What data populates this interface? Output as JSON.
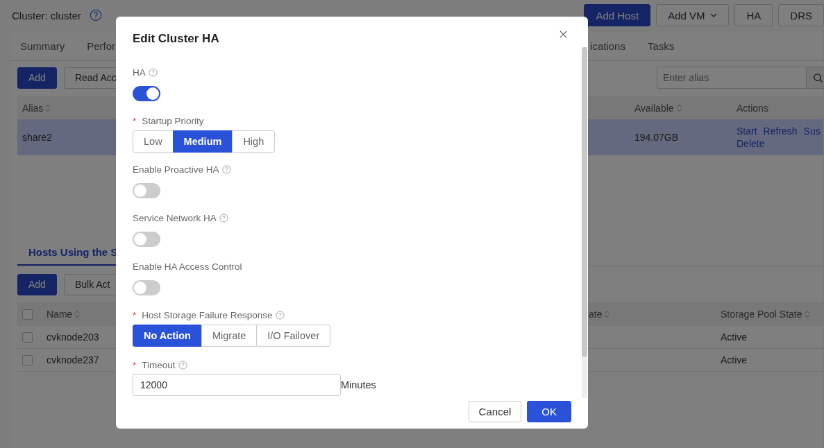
{
  "header": {
    "title": "Cluster: cluster",
    "buttons": [
      {
        "label": "Add Host",
        "kind": "primary"
      },
      {
        "label": "Add VM",
        "kind": "dropdown"
      },
      {
        "label": "HA",
        "kind": "plain"
      },
      {
        "label": "DRS",
        "kind": "plain"
      }
    ]
  },
  "tabs": [
    {
      "label": "Summary",
      "selected": false
    },
    {
      "label": "Perfor",
      "selected": false
    },
    {
      "label": "ications",
      "selected": false
    },
    {
      "label": "Tasks",
      "selected": false
    }
  ],
  "storage": {
    "buttons": [
      {
        "label": "Add",
        "kind": "primary"
      },
      {
        "label": "Read Acc",
        "kind": "plain"
      }
    ],
    "search": {
      "placeholder": "Enter alias"
    },
    "columns": [
      "Alias",
      "Available",
      "Actions"
    ],
    "rows": [
      {
        "alias": "share2",
        "available": "194.07GB",
        "selected": true,
        "actions": [
          "Start",
          "Refresh",
          "Sus",
          "Delete"
        ]
      }
    ]
  },
  "hosts": {
    "tab": {
      "label": "Hosts Using the S",
      "selected": true
    },
    "buttons": [
      {
        "label": "Add",
        "kind": "primary"
      },
      {
        "label": "Bulk Act",
        "kind": "plain"
      }
    ],
    "columns": [
      "Name",
      "ate",
      "Storage Pool State"
    ],
    "all_checked": false,
    "rows": [
      {
        "name": "cvknode203",
        "state": "Active",
        "checked": false
      },
      {
        "name": "cvknode237",
        "state": "Active",
        "checked": false
      }
    ]
  },
  "modal": {
    "title": "Edit Cluster HA",
    "fields": [
      {
        "kind": "switch",
        "label": "HA",
        "help": true,
        "on": true
      },
      {
        "kind": "segmented",
        "label": "Startup Priority",
        "required_mark": "*",
        "help": false,
        "options": [
          {
            "label": "Low",
            "selected": false
          },
          {
            "label": "Medium",
            "selected": true
          },
          {
            "label": "High",
            "selected": false
          }
        ]
      },
      {
        "kind": "switch",
        "label": "Enable Proactive HA",
        "help": true,
        "on": false
      },
      {
        "kind": "switch",
        "label": "Service Network HA",
        "help": true,
        "on": false
      },
      {
        "kind": "switch",
        "label": "Enable HA Access Control",
        "help": false,
        "on": false
      },
      {
        "kind": "segmented",
        "label": "Host Storage Failure Response",
        "required_mark": "*",
        "help": true,
        "options": [
          {
            "label": "No Action",
            "selected": true
          },
          {
            "label": "Migrate",
            "selected": false
          },
          {
            "label": "I/O Failover",
            "selected": false
          }
        ]
      },
      {
        "kind": "input",
        "label": "Timeout",
        "required_mark": "*",
        "help": true,
        "value": "12000",
        "suffix": "Minutes"
      }
    ],
    "buttons": [
      {
        "label": "Cancel",
        "kind": "plain"
      },
      {
        "label": "OK",
        "kind": "primary"
      }
    ]
  }
}
